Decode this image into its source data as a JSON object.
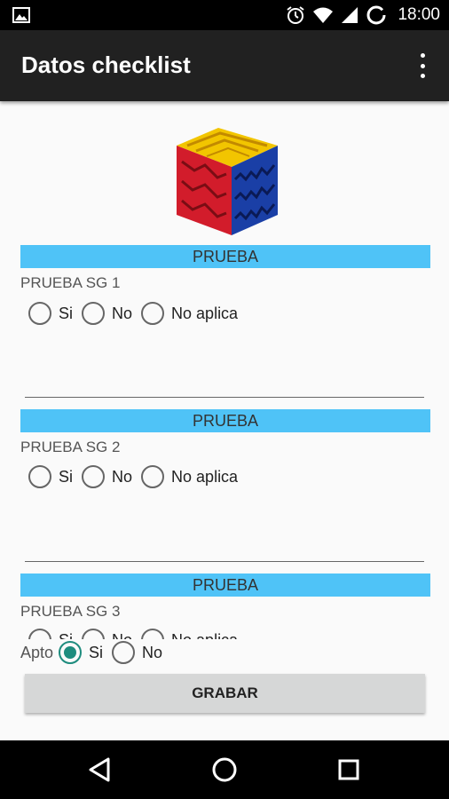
{
  "status_bar": {
    "time": "18:00",
    "icons": [
      "gallery-icon",
      "alarm-icon",
      "wifi-icon",
      "signal-icon",
      "battery-icon"
    ]
  },
  "app_bar": {
    "title": "Datos checklist",
    "menu_icon": "overflow-menu-icon"
  },
  "sections": [
    {
      "header": "PRUEBA",
      "question": "PRUEBA SG 1",
      "options": [
        "Si",
        "No",
        "No aplica"
      ]
    },
    {
      "header": "PRUEBA",
      "question": "PRUEBA SG 2",
      "options": [
        "Si",
        "No",
        "No aplica"
      ]
    },
    {
      "header": "PRUEBA",
      "question": "PRUEBA SG 3",
      "options": [
        "Si",
        "No",
        "No aplica"
      ]
    }
  ],
  "apto": {
    "label": "Apto",
    "options": [
      "Si",
      "No"
    ],
    "selected": "Si"
  },
  "grabar_button": "GRABAR",
  "nav_bar": {
    "icons": [
      "back-icon",
      "home-icon",
      "recents-icon"
    ]
  },
  "colors": {
    "section_header": "#4fc3f7",
    "app_bar": "#212121",
    "radio_accent": "#1e8c7e",
    "button": "#d6d7d7"
  }
}
